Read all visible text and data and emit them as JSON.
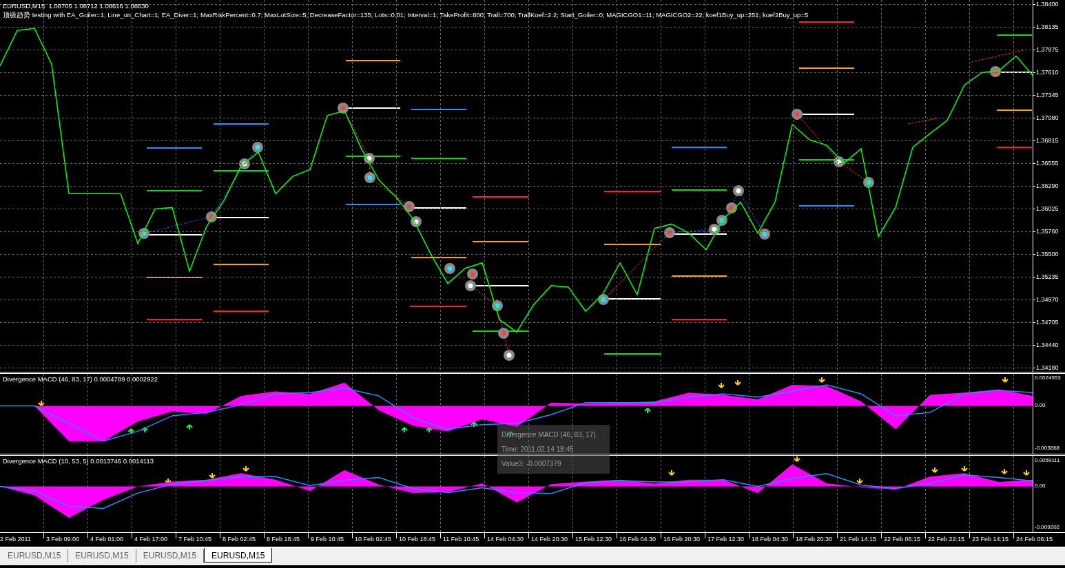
{
  "main_chart": {
    "symbol_line": "EURUSD,M15  1.08705 1.08712 1.08616 1.08630",
    "settings_line": "顶级趋势 testing with EA_Goiler=1; Line_on_Chart=1; EA_Diver=1; MaxRiskPercent=0.7; MaxLotSize=5; DecreaseFactor=135; Lots=0.01; Interval=1; TakeProfit=800; Trall=700; TrallKoef=2.2; Start_Goiler=0; MAGICGO1=11; MAGICGO2=22; koef1Buy_up=251; koef2Buy_up=5",
    "chart_data": {
      "type": "line",
      "grid": true,
      "ylim": [
        1.3418,
        1.384
      ],
      "yticks": [
        {
          "value": 1.384,
          "label": "1.38400"
        },
        {
          "value": 1.38135,
          "label": "1.38135"
        },
        {
          "value": 1.37875,
          "label": "1.37875"
        },
        {
          "value": 1.3761,
          "label": "1.37610"
        },
        {
          "value": 1.37345,
          "label": "1.37345"
        },
        {
          "value": 1.3708,
          "label": "1.37080"
        },
        {
          "value": 1.36815,
          "label": "1.36815"
        },
        {
          "value": 1.36555,
          "label": "1.36555"
        },
        {
          "value": 1.3629,
          "label": "1.36290"
        },
        {
          "value": 1.36025,
          "label": "1.36025"
        },
        {
          "value": 1.3576,
          "label": "1.35760"
        },
        {
          "value": 1.355,
          "label": "1.35500"
        },
        {
          "value": 1.35235,
          "label": "1.35235"
        },
        {
          "value": 1.3497,
          "label": "1.34970"
        },
        {
          "value": 1.34705,
          "label": "1.34705"
        },
        {
          "value": 1.3444,
          "label": "1.34440"
        },
        {
          "value": 1.3418,
          "label": "1.34180"
        }
      ],
      "series": [
        {
          "color": "#00ff00",
          "values": [
            1.37685,
            1.38095,
            1.38119,
            1.37701,
            1.362,
            1.362,
            1.362,
            1.362,
            1.35622,
            1.36023,
            1.36039,
            1.353,
            1.35822,
            1.3612,
            1.36521,
            1.36682,
            1.362,
            1.36401,
            1.36481,
            1.37107,
            1.37163,
            1.36714,
            1.3636,
            1.3616,
            1.35903,
            1.35501,
            1.35156,
            1.35333,
            1.35397,
            1.34738,
            1.34594,
            1.34915,
            1.35132,
            1.35116,
            1.34835,
            1.35035,
            1.35397,
            1.35027,
            1.35798,
            1.35847,
            1.35742,
            1.35549,
            1.35903,
            1.36103,
            1.35742,
            1.36103,
            1.37003,
            1.36826,
            1.36762,
            1.36553,
            1.36722,
            1.35702,
            1.36039,
            1.36738,
            1.36898,
            1.37051,
            1.37461,
            1.37605,
            1.37629,
            1.37798,
            1.37565
          ]
        }
      ]
    }
  },
  "indicators": [
    {
      "label": "Divergence MACD (46, 83, 17) 0.0004789 0.0002922",
      "chart_data": {
        "type": "area",
        "grid": true,
        "ylim": [
          -0.004336,
          0.0029
        ],
        "yticks": [
          {
            "value": 0.0024953,
            "label": "0.0024953"
          },
          {
            "value": 0,
            "label": "0.00"
          },
          {
            "value": -0.003868,
            "label": "-0.003868"
          }
        ],
        "series": [
          {
            "color": "#ff00ff",
            "values": [
              0,
              0,
              -0.0032,
              -0.0032,
              -0.0014,
              -0.0005,
              -0.0007,
              0.0009,
              0.0013,
              0.0011,
              0.0021,
              -0.0004,
              -0.0018,
              -0.0023,
              -0.0012,
              -0.0019,
              0.0003,
              0.0002,
              0.0003,
              0.0004,
              0.0012,
              0.001,
              0.0006,
              0.0019,
              0.0018,
              0.0004,
              -0.0021,
              0.001,
              0.0012,
              0.0015,
              0.0009
            ]
          },
          {
            "type": "line",
            "color": "#1e90ff",
            "values": [
              0,
              0,
              -0.0016,
              -0.0032,
              -0.0023,
              -0.0009,
              -0.0006,
              0.0001,
              0.0011,
              0.0012,
              0.0016,
              0.0009,
              -0.0011,
              -0.0021,
              -0.0017,
              -0.0016,
              -0.0008,
              0.0003,
              0.0003,
              0.0003,
              0.0008,
              0.0011,
              0.0008,
              0.0013,
              0.0019,
              0.0011,
              -0.0009,
              -0.0006,
              0.0011,
              0.0014,
              0.0012
            ]
          }
        ]
      }
    },
    {
      "label": "Divergence MACD (10, 53, 5) 0.0013746 0.0014113",
      "chart_data": {
        "type": "area",
        "grid": true,
        "ylim": [
          -0.01037,
          0.006924
        ],
        "yticks": [
          {
            "value": 0.0059111,
            "label": "0.0059111"
          },
          {
            "value": 0,
            "label": "0.00"
          },
          {
            "value": -0.0092024,
            "label": "-0.009202"
          }
        ],
        "series": [
          {
            "color": "#ff00ff",
            "values": [
              0,
              -0.002,
              -0.0071,
              -0.003,
              0,
              0.0011,
              0.0015,
              0.003,
              0.0015,
              -0.001,
              0.0037,
              0.0004,
              -0.0015,
              -0.0013,
              0.0007,
              -0.0036,
              0.0005,
              0.0011,
              0.0015,
              0.0006,
              0.0015,
              0.0015,
              -0.0015,
              0.005,
              0.0007,
              -0.0002,
              -0.0007,
              0.0022,
              0.003,
              0.001,
              0.0015
            ]
          },
          {
            "type": "line",
            "color": "#1e90ff",
            "values": [
              0,
              -0.001,
              -0.0045,
              -0.005,
              -0.0015,
              0.0005,
              0.0013,
              0.0022,
              0.0022,
              0.0002,
              0.0014,
              0.002,
              -0.0005,
              -0.0014,
              -0.0003,
              -0.0014,
              -0.0016,
              0.0008,
              0.0013,
              0.001,
              0.001,
              0.0015,
              0,
              0.0018,
              0.0029,
              0.0003,
              -0.0005,
              0.0007,
              0.0026,
              0.002,
              0.0012
            ]
          }
        ]
      }
    }
  ],
  "tooltip": {
    "lines": [
      "Divergence MACD (46, 83, 17)",
      "Time: 2011.02.14 18:45",
      "Value3: -0.0007379"
    ]
  },
  "time_axis": [
    "2 Feb 2011",
    "3 Feb 09:00",
    "4 Feb 01:00",
    "4 Feb 17:00",
    "7 Feb 10:45",
    "8 Feb 02:45",
    "8 Feb 18:45",
    "9 Feb 10:45",
    "10 Feb 02:45",
    "10 Feb 18:45",
    "11 Feb 10:45",
    "14 Feb 04:30",
    "14 Feb 20:30",
    "15 Feb 12:30",
    "16 Feb 04:30",
    "16 Feb 20:30",
    "17 Feb 12:30",
    "18 Feb 04:30",
    "18 Feb 20:30",
    "21 Feb 14:15",
    "22 Feb 06:15",
    "22 Feb 22:15",
    "23 Feb 14:15",
    "24 Feb 06:15"
  ],
  "tabs": [
    {
      "label": "EURUSD,M15",
      "selected": false
    },
    {
      "label": "EURUSD,M15",
      "selected": false
    },
    {
      "label": "EURUSD,M15",
      "selected": false
    },
    {
      "label": "EURUSD,M15",
      "selected": true
    }
  ]
}
